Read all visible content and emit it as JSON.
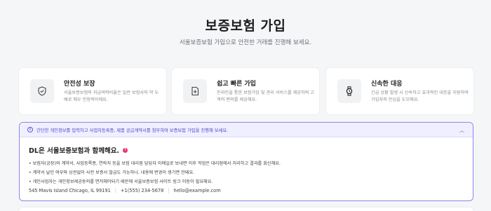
{
  "header": {
    "title": "보증보험 가입",
    "subtitle": "서울보증보험 가입으로 안전한 거래를 진행해 보세요."
  },
  "features": [
    {
      "icon": "shield-check-icon",
      "title": "안전성 보장",
      "desc": "서울보증보험의 지급여력비율은 일반 보험사의 약 두배로 매우 안정적이에요."
    },
    {
      "icon": "document-add-icon",
      "title": "쉽고 빠른 가입",
      "desc": "온라인을 통한 보험가입 및 관리 서비스를 제공하여 고객의 편의를 제공해요."
    },
    {
      "icon": "watch-icon",
      "title": "신속한 대응",
      "desc": "긴급 상황 발생 시 신속하고 효과적인 대응을 지원하여 가입자의 안심을 도모해요."
    }
  ],
  "notice": {
    "header_text": "간단한 개인정보를 입력하고 사업자등록증, 제품 공급계약서를 첨부하여 보증보험 가입을 진행해 보세요.",
    "title": "DL은 서울보증보험과 함께해요.",
    "badge": "!",
    "bullets": [
      "• 보험자(공장)의 계약서, 사업등록증, 연락처 등을 보험 대리점 담당자 이메일로 보내면 이후 작업은 대리점에서 처리하고 결과를 회신해요.",
      "• 계약서 날인 여부와 상관없이 사전 보증서 발급도 가능하나, 내용에 변경이 생기면 안돼요.",
      "• 개인사업자는 개인정보제공동의를 면저해야되기 때문에 서울보증보험 사이트 링크 이동이 필요해요."
    ],
    "contact": {
      "address": "545 Mavis Island Chicago, IL 99191",
      "phone": "+1(555) 234-5678",
      "email": "hello@example.com"
    }
  }
}
